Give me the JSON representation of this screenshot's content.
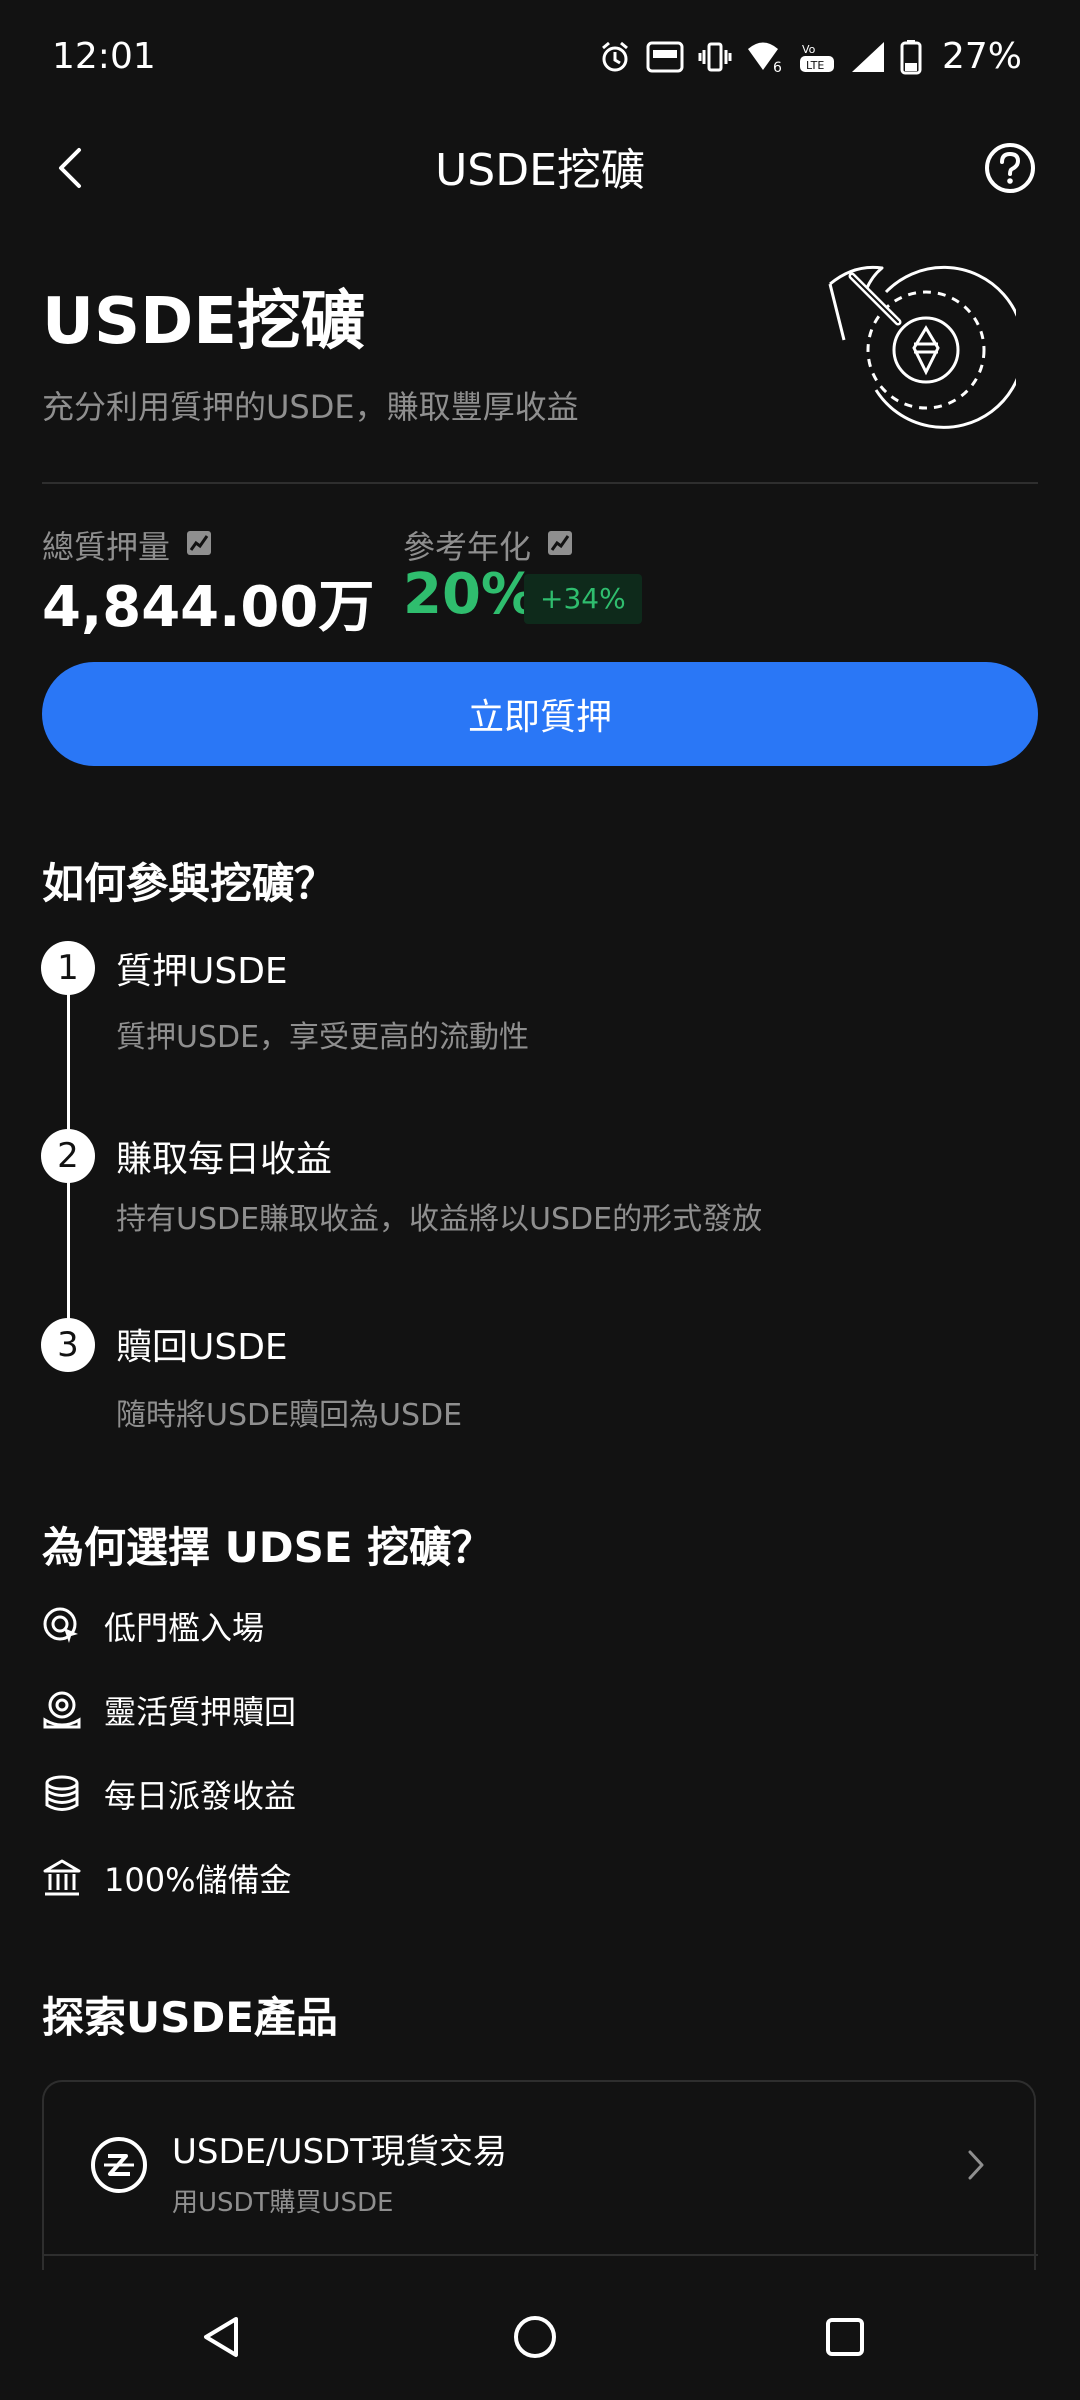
{
  "status_bar": {
    "time": "12:01",
    "battery_percent": "27%",
    "icons": [
      "alarm-icon",
      "auto-hz-icon",
      "vibrate-icon",
      "wifi-6-icon",
      "volte-icon",
      "signal-icon",
      "battery-icon"
    ]
  },
  "header": {
    "title": "USDE挖礦",
    "back_icon": "chevron-left-icon",
    "help_icon": "question-circle-icon"
  },
  "hero": {
    "title": "USDE挖礦",
    "subtitle": "充分利用質押的USDE，賺取豐厚收益",
    "illustration": "pickaxe-coin-icon"
  },
  "stats": {
    "total_staked_label": "總質押量",
    "total_staked_value": "4,844.00万",
    "apr_label": "參考年化",
    "apr_value": "20%",
    "apr_change": "+34%",
    "chart_icon": "mini-chart-icon"
  },
  "cta": {
    "label": "立即質押"
  },
  "how": {
    "title": "如何參與挖礦？",
    "steps": [
      {
        "num": "1",
        "title": "質押USDE",
        "desc": "質押USDE，享受更高的流動性"
      },
      {
        "num": "2",
        "title": "賺取每日收益",
        "desc": "持有USDE賺取收益，收益將以USDE的形式發放"
      },
      {
        "num": "3",
        "title": "贖回USDE",
        "desc": "隨時將USDE贖回為USDE"
      }
    ]
  },
  "why": {
    "title": "為何選擇 UDSE 挖礦？",
    "items": [
      {
        "label": "低門檻入場",
        "icon": "target-cursor-icon"
      },
      {
        "label": "靈活質押贖回",
        "icon": "coin-hand-icon"
      },
      {
        "label": "每日派發收益",
        "icon": "coin-stack-icon"
      },
      {
        "label": "100%儲備金",
        "icon": "bank-icon"
      }
    ]
  },
  "explore": {
    "title": "探索USDE產品",
    "products": [
      {
        "title": "USDE/USDT現貨交易",
        "subtitle": "用USDT購買USDE",
        "icon": "usde-logo-icon"
      }
    ]
  },
  "colors": {
    "background": "#121212",
    "primary_blue": "#2a77f6",
    "positive_green": "#2fbd6e",
    "muted_text": "#8f8f8f"
  },
  "nav_bar": {
    "icons": [
      "back-triangle-icon",
      "home-circle-icon",
      "recents-square-icon"
    ]
  }
}
